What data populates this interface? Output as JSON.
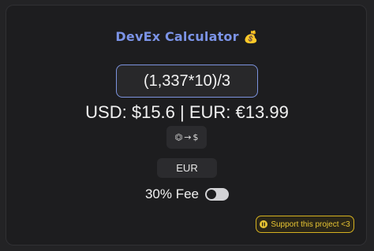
{
  "app": {
    "title": "DevEx Calculator",
    "title_icon": "money-bag-icon",
    "title_emoji": "💰"
  },
  "calculator": {
    "expression": "(1,337*10)/3",
    "result_text": "USD: $15.6 | EUR: €13.99"
  },
  "convert_button": {
    "icon": "robux-icon",
    "from_symbol": "⏣",
    "arrow": "→",
    "to_symbol": "$"
  },
  "currency_button": {
    "label": "EUR"
  },
  "fee": {
    "label": "30% Fee",
    "enabled": false
  },
  "support": {
    "label": "Support this project <3",
    "icon": "support-icon"
  },
  "colors": {
    "accent": "#7b93e6",
    "support_border": "#d6b220",
    "support_text": "#e8c533",
    "background": "#1d1d1f"
  }
}
